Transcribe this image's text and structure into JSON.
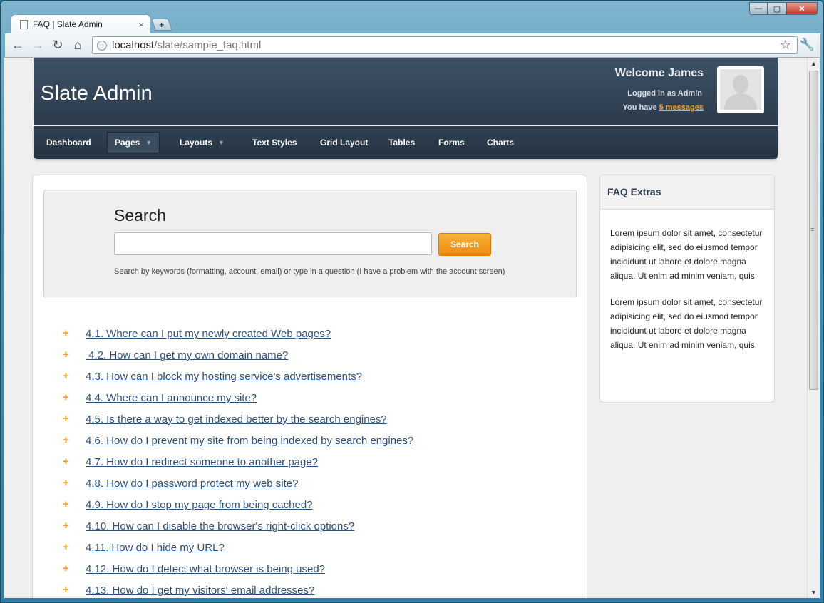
{
  "browser": {
    "tab_title": "FAQ | Slate Admin",
    "tab_close": "×",
    "new_tab": "+",
    "url_host": "localhost",
    "url_path": "/slate/sample_faq.html",
    "back": "←",
    "forward": "→",
    "reload": "↻",
    "home": "⌂",
    "star": "☆",
    "wrench": "🔧",
    "win_min": "—",
    "win_max": "▢",
    "win_close": "✕"
  },
  "header": {
    "logo": "Slate Admin",
    "welcome": "Welcome James",
    "logged_in": "Logged in as Admin",
    "messages_prefix": "You have ",
    "messages_link": "5 messages"
  },
  "nav": {
    "items": [
      {
        "label": "Dashboard"
      },
      {
        "label": "Pages"
      },
      {
        "label": "Layouts"
      },
      {
        "label": "Text Styles"
      },
      {
        "label": "Grid Layout"
      },
      {
        "label": "Tables"
      },
      {
        "label": "Forms"
      },
      {
        "label": "Charts"
      }
    ],
    "caret": "▼"
  },
  "search": {
    "title": "Search",
    "button": "Search",
    "hint": "Search by keywords (formatting, account, email) or type in a question (I have a problem with the account screen)"
  },
  "faq": {
    "plus": "+",
    "items": [
      "4.1. Where can I put my newly created Web pages?",
      " 4.2. How can I get my own domain name?",
      "4.3. How can I block my hosting service's advertisements?",
      "4.4. Where can I announce my site?",
      "4.5. Is there a way to get indexed better by the search engines?",
      "4.6. How do I prevent my site from being indexed by search engines?",
      "4.7. How do I redirect someone to another page?",
      "4.8. How do I password protect my web site?",
      "4.9. How do I stop my page from being cached?",
      "4.10. How can I disable the browser's right-click options?",
      "4.11. How do I hide my URL?",
      "4.12. How do I detect what browser is being used?",
      "4.13. How do I get my visitors' email addresses?"
    ]
  },
  "sidebar": {
    "title": "FAQ Extras",
    "paragraphs": [
      "Lorem ipsum dolor sit amet, consectetur adipisicing elit, sed do eiusmod tempor incididunt ut labore et dolore magna aliqua. Ut enim ad minim veniam, quis.",
      "Lorem ipsum dolor sit amet, consectetur adipisicing elit, sed do eiusmod tempor incididunt ut labore et dolore magna aliqua. Ut enim ad minim veniam, quis."
    ]
  },
  "scrollbar": {
    "up": "▲",
    "down": "▼",
    "grip": "≡"
  }
}
